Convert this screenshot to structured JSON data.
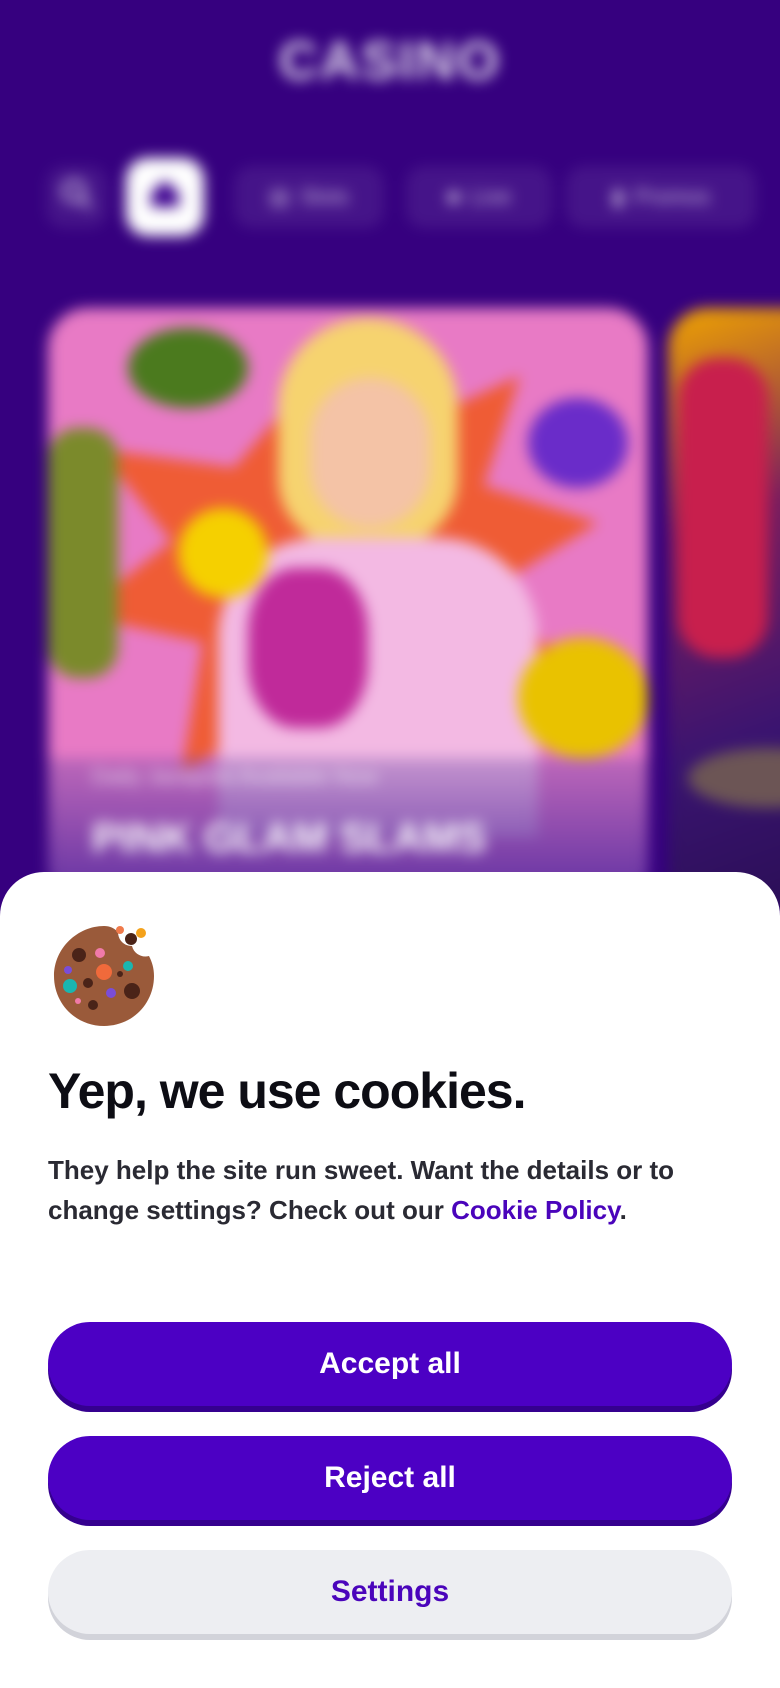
{
  "background_app": {
    "brand": "CASINO",
    "nav": {
      "search_icon": "search-icon",
      "home_icon": "home-icon",
      "slots_label": "Slots",
      "live_label": "Live",
      "promos_label": "Promos"
    },
    "hero": {
      "subtitle": "Daily Jackpots Available Now",
      "title": "PINK GLAM SLAMS"
    }
  },
  "cookie_banner": {
    "icon": "cookie-icon",
    "title": "Yep, we use cookies.",
    "description_text": "They help the site run sweet. Want the details or to change settings? Check out our ",
    "policy_link": "Cookie Policy",
    "description_end": ".",
    "accept_label": "Accept all",
    "reject_label": "Reject all",
    "settings_label": "Settings"
  },
  "colors": {
    "brand_purple": "#4c00c4",
    "background_purple": "#36007f",
    "link_purple": "#4a04bb",
    "secondary_button": "#edeef2",
    "cookie_brown": "#9a5a3a"
  }
}
